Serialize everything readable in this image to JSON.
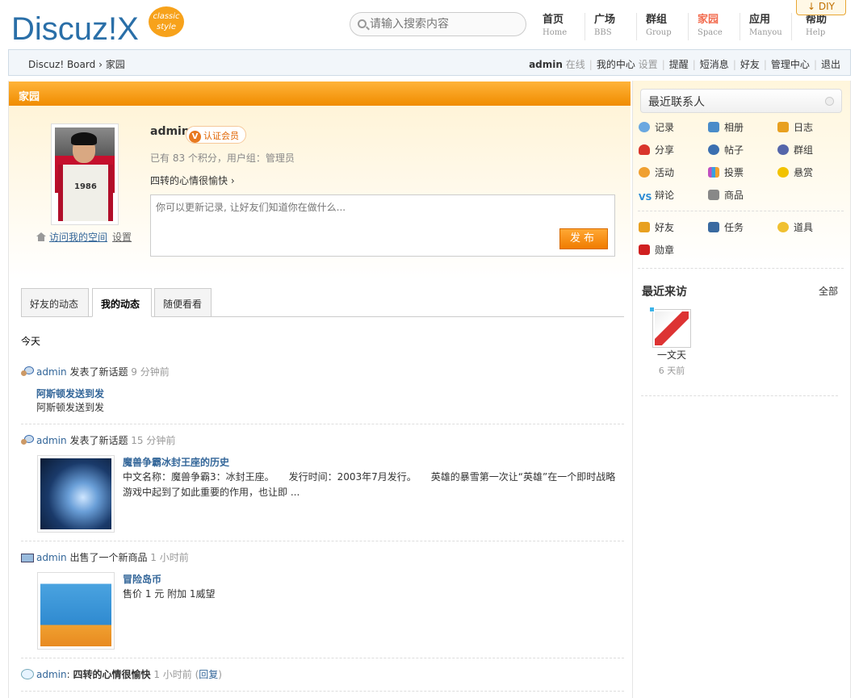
{
  "logo": {
    "text": "Discuz!X",
    "badge": "classic style"
  },
  "search": {
    "placeholder": "请输入搜索内容"
  },
  "nav": [
    {
      "cn": "首页",
      "en": "Home"
    },
    {
      "cn": "广场",
      "en": "BBS"
    },
    {
      "cn": "群组",
      "en": "Group"
    },
    {
      "cn": "家园",
      "en": "Space"
    },
    {
      "cn": "应用",
      "en": "Manyou"
    },
    {
      "cn": "帮助",
      "en": "Help"
    }
  ],
  "diy": "DIY",
  "breadcrumb": {
    "home": "Discuz! Board",
    "sep": "›",
    "current": "家园"
  },
  "userbar": {
    "username": "admin",
    "status": "在线",
    "my_center": "我的中心",
    "settings": "设置",
    "remind": "提醒",
    "messages": "短消息",
    "friends": "好友",
    "admin_center": "管理中心",
    "logout": "退出"
  },
  "section_title": "家园",
  "profile": {
    "name": "admin",
    "verified": "认证会员",
    "verified_icon": "V",
    "points": "已有 83 个积分，用户组：管理员",
    "mood": "四转的心情很愉快 ›",
    "visit_link": "访问我的空间",
    "settings": "设置",
    "status_placeholder": "你可以更新记录, 让好友们知道你在做什么...",
    "publish": "发布"
  },
  "tabs": [
    "好友的动态",
    "我的动态",
    "随便看看"
  ],
  "today": "今天",
  "feeds": [
    {
      "user": "admin",
      "action": "发表了新话题",
      "time": "9 分钟前",
      "title": "阿斯顿发送到发",
      "body": "阿斯顿发送到发"
    },
    {
      "user": "admin",
      "action": "发表了新话题",
      "time": "15 分钟前",
      "title": "魔兽争霸冰封王座的历史",
      "body": "中文名称：魔兽争霸3：冰封王座。　　发行时间：2003年7月发行。　　英雄的暴雪第一次让“英雄”在一个即时战略游戏中起到了如此重要的作用，也让即 ..."
    },
    {
      "user": "admin",
      "action": "出售了一个新商品",
      "time": "1 小时前",
      "title": "冒险岛币",
      "body": "售价 1 元 附加 1威望"
    },
    {
      "user": "admin",
      "action_bold": "四转的心情很愉快",
      "time": "1 小时前",
      "reply": "回复"
    }
  ],
  "sidebar": {
    "recent_contacts": "最近联系人",
    "apps": [
      {
        "label": "记录",
        "icon": "speech-bubble-icon",
        "color": "#6aa8e0"
      },
      {
        "label": "相册",
        "icon": "photo-album-icon",
        "color": "#4a8cc9"
      },
      {
        "label": "日志",
        "icon": "notebook-icon",
        "color": "#e8a020"
      },
      {
        "label": "分享",
        "icon": "hearts-icon",
        "color": "#d9352b"
      },
      {
        "label": "帖子",
        "icon": "post-icon",
        "color": "#3b6fb0"
      },
      {
        "label": "群组",
        "icon": "group-icon",
        "color": "#5566aa"
      },
      {
        "label": "活动",
        "icon": "people-icon",
        "color": "#f0a030"
      },
      {
        "label": "投票",
        "icon": "bar-chart-icon",
        "color": "#c04fc0"
      },
      {
        "label": "悬赏",
        "icon": "gold-ingot-icon",
        "color": "#f2c200"
      },
      {
        "label": "辩论",
        "icon": "vs-icon",
        "color": "#2a8ad4"
      },
      {
        "label": "商品",
        "icon": "cart-icon",
        "color": "#888888"
      },
      {
        "label": "好友",
        "icon": "handshake-icon",
        "color": "#e8a020"
      },
      {
        "label": "任务",
        "icon": "task-icon",
        "color": "#3a6aa0"
      },
      {
        "label": "道具",
        "icon": "magic-wand-icon",
        "color": "#f0c030"
      },
      {
        "label": "勋章",
        "icon": "medal-icon",
        "color": "#d02020"
      }
    ],
    "recent_visitors": "最近来访",
    "all": "全部",
    "visitor": {
      "name": "一文天",
      "time": "6 天前"
    }
  }
}
